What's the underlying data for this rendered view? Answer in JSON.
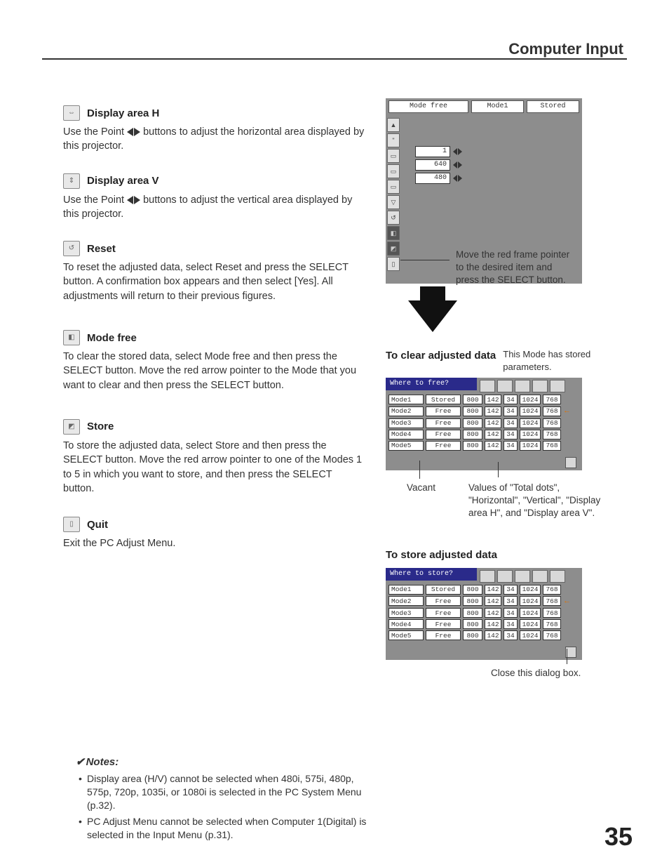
{
  "header": "Computer Input",
  "page_number": "35",
  "sections": [
    {
      "title": "Display area H",
      "icon": "display-h-icon",
      "body_pre": "Use the Point ",
      "body_post": " buttons to adjust the horizontal area displayed by this projector.",
      "arrows": true
    },
    {
      "title": "Display area V",
      "icon": "display-v-icon",
      "body_pre": "Use the Point ",
      "body_post": " buttons to adjust the vertical area displayed by this projector.",
      "arrows": true
    },
    {
      "title": "Reset",
      "icon": "reset-icon",
      "body": "To reset the adjusted data, select Reset and press the SELECT button. A confirmation box appears and then select [Yes]. All adjustments will return to their previous figures."
    },
    {
      "title": "Mode free",
      "icon": "mode-free-icon",
      "body": "To clear the stored data, select Mode free and then press the SELECT button. Move the red arrow pointer to the Mode that you want to clear and then press the SELECT button."
    },
    {
      "title": "Store",
      "icon": "store-icon",
      "body": "To store the adjusted data, select Store and then press the SELECT button. Move the red arrow pointer to one of the Modes 1 to 5 in which you want to store, and then press the SELECT button."
    },
    {
      "title": "Quit",
      "icon": "quit-icon",
      "body": "Exit the PC Adjust Menu."
    }
  ],
  "menu": {
    "top_labels": [
      "Mode free",
      "Mode1",
      "Stored"
    ],
    "values": [
      "1",
      "640",
      "480"
    ],
    "hint": "Move the red frame pointer to the desired item and press the SELECT button."
  },
  "clear_section": {
    "heading": "To clear adjusted data",
    "side_note": "This Mode has stored parameters.",
    "table_title": "Where to free?",
    "vacant_label": "Vacant",
    "values_label": "Values of \"Total dots\", \"Horizontal\", \"Vertical\", \"Display area H\", and \"Display area V\"."
  },
  "store_section": {
    "heading": "To store adjusted data",
    "table_title": "Where to store?",
    "close_label": "Close this dialog box."
  },
  "mode_rows": [
    {
      "mode": "Mode1",
      "status": "Stored",
      "vals": [
        "800",
        "142",
        "34",
        "1024",
        "768"
      ],
      "arrow": false
    },
    {
      "mode": "Mode2",
      "status": "Free",
      "vals": [
        "800",
        "142",
        "34",
        "1024",
        "768"
      ],
      "arrow": true
    },
    {
      "mode": "Mode3",
      "status": "Free",
      "vals": [
        "800",
        "142",
        "34",
        "1024",
        "768"
      ],
      "arrow": false
    },
    {
      "mode": "Mode4",
      "status": "Free",
      "vals": [
        "800",
        "142",
        "34",
        "1024",
        "768"
      ],
      "arrow": false
    },
    {
      "mode": "Mode5",
      "status": "Free",
      "vals": [
        "800",
        "142",
        "34",
        "1024",
        "768"
      ],
      "arrow": false
    }
  ],
  "notes": {
    "title": "Notes:",
    "items": [
      "Display area (H/V) cannot be selected when 480i, 575i, 480p, 575p, 720p, 1035i, or 1080i is selected in the PC System Menu (p.32).",
      "PC Adjust Menu cannot be selected when Computer 1(Digital) is selected in the Input Menu (p.31)."
    ]
  }
}
